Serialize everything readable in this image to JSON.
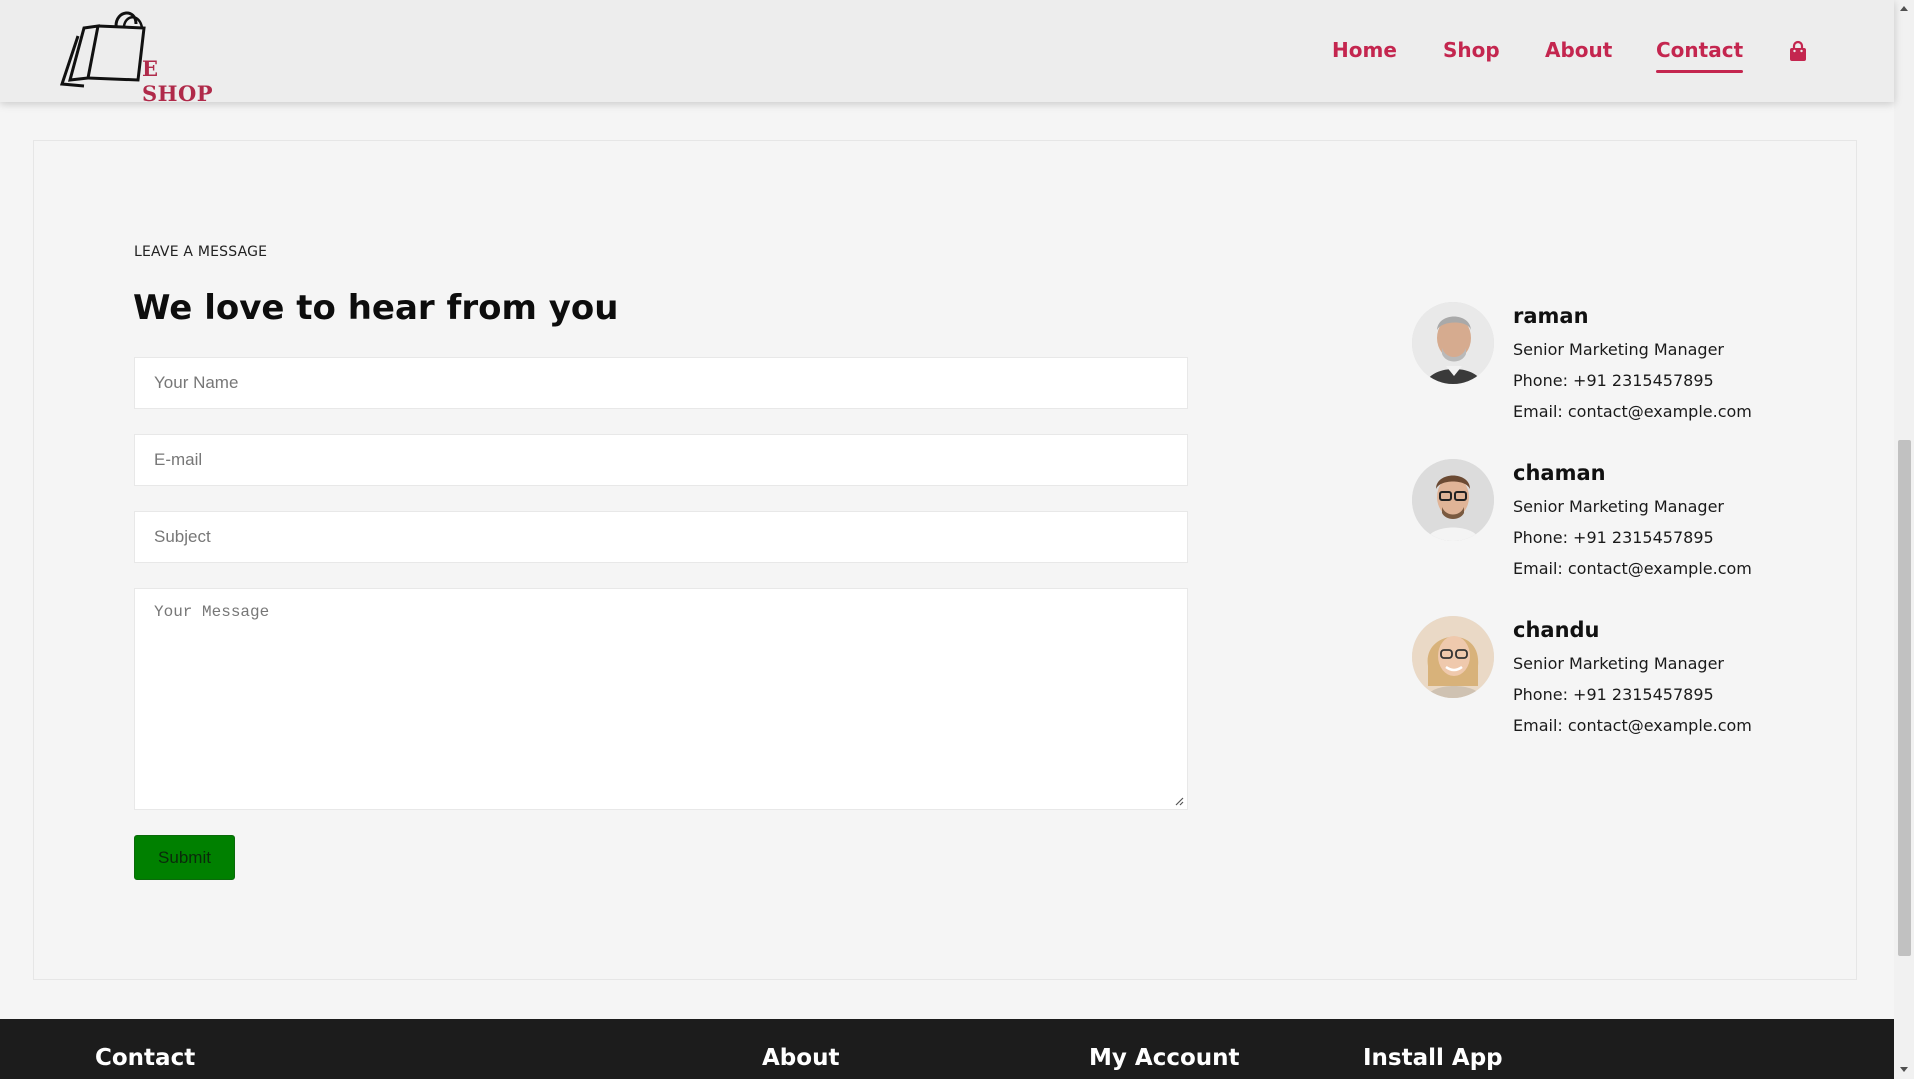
{
  "header": {
    "logo_text": "E SHOP",
    "nav": [
      {
        "label": "Home",
        "active": false
      },
      {
        "label": "Shop",
        "active": false
      },
      {
        "label": "About",
        "active": false
      },
      {
        "label": "Contact",
        "active": true
      }
    ],
    "cart_icon": "shopping-bag-icon",
    "accent_color": "#c4264f"
  },
  "form": {
    "eyebrow": "LEAVE A MESSAGE",
    "heading": "We love to hear from you",
    "name_placeholder": "Your Name",
    "email_placeholder": "E-mail",
    "subject_placeholder": "Subject",
    "message_placeholder": "Your Message",
    "submit_label": "Submit",
    "submit_color": "#008000"
  },
  "contacts": [
    {
      "name": "raman",
      "title": "Senior Marketing Manager",
      "phone": "Phone: +91 2315457895",
      "email": "Email: contact@example.com"
    },
    {
      "name": "chaman",
      "title": "Senior Marketing Manager",
      "phone": "Phone: +91 2315457895",
      "email": "Email: contact@example.com"
    },
    {
      "name": "chandu",
      "title": "Senior Marketing Manager",
      "phone": "Phone: +91 2315457895",
      "email": "Email: contact@example.com"
    }
  ],
  "footer": {
    "headings": [
      "Contact",
      "About",
      "My Account",
      "Install App"
    ]
  }
}
